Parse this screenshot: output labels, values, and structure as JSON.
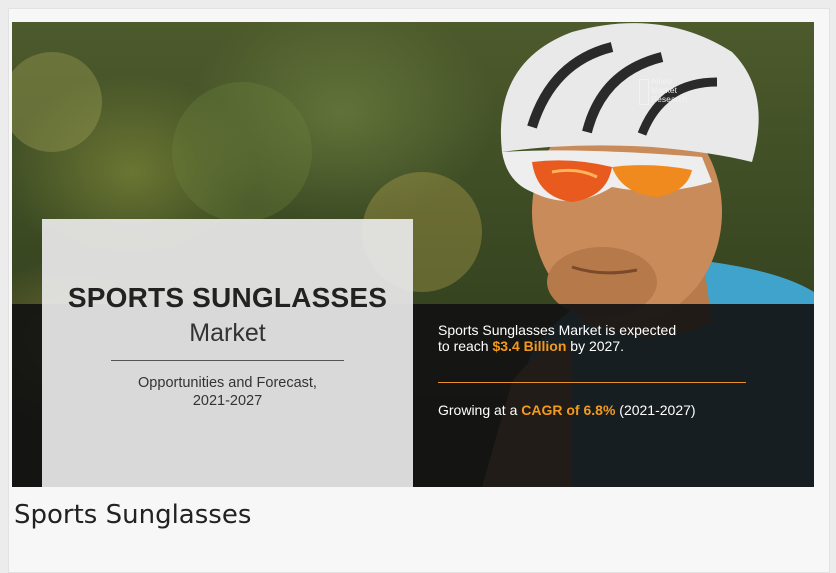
{
  "banner": {
    "title_main": "SPORTS SUNGLASSES",
    "title_sub": "Market",
    "forecast_line1": "Opportunities and Forecast,",
    "forecast_line2": "2021-2027",
    "stat1_pre": "Sports Sunglasses Market is expected",
    "stat1_mid": "to reach ",
    "stat1_value": "$3.4 Billion",
    "stat1_post": " by 2027.",
    "stat2_pre": "Growing at a ",
    "stat2_value": "CAGR of 6.8%",
    "stat2_post": " (2021-2027)",
    "logo_text": [
      "Allied",
      "Market",
      "Research"
    ],
    "accent_color": "#f39a1e"
  },
  "caption": "Sports Sunglasses"
}
